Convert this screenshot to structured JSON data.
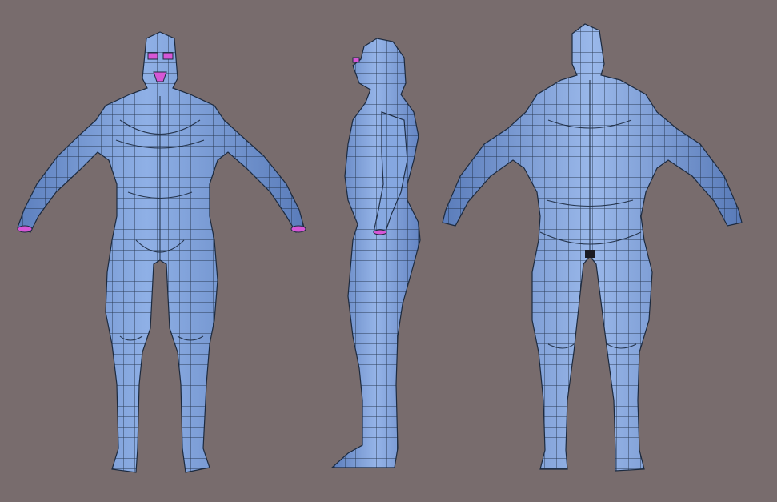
{
  "scene": {
    "background_color": "#786c6d",
    "mesh_fill_color": "#7ea2dc",
    "mesh_highlight_color": "#a9c3ee",
    "mesh_shadow_color": "#4f6fa8",
    "wire_color": "#1c2a3f",
    "accent_color": "#d657d6",
    "views": [
      {
        "id": "front",
        "name": "front-view"
      },
      {
        "id": "side",
        "name": "side-view"
      },
      {
        "id": "back",
        "name": "back-view"
      }
    ]
  }
}
